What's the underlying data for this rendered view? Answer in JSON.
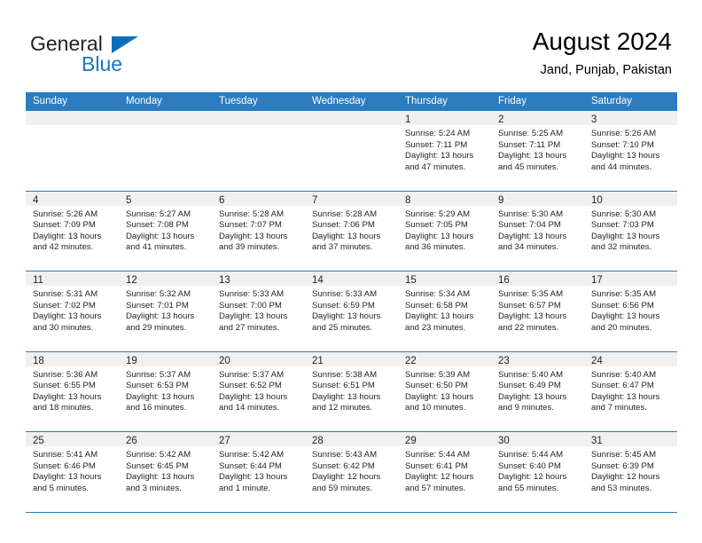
{
  "brand": {
    "name_part1": "General",
    "name_part2": "Blue",
    "triangle_icon": "brand-triangle-icon",
    "colors": {
      "general_text": "#231f20",
      "blue_text": "#1878bd",
      "triangle": "#0b6fba"
    }
  },
  "header": {
    "title": "August 2024",
    "subtitle": "Jand, Punjab, Pakistan"
  },
  "theme": {
    "header_bar": "#2b7cc0",
    "daynum_strip": "#f0f0f0",
    "row_divider": "#2b7cc0",
    "text": "#231f20"
  },
  "weekday_headers": [
    "Sunday",
    "Monday",
    "Tuesday",
    "Wednesday",
    "Thursday",
    "Friday",
    "Saturday"
  ],
  "weeks": [
    [
      {
        "day": "",
        "empty": true,
        "sunrise": "",
        "sunset": "",
        "daylight1": "",
        "daylight2": ""
      },
      {
        "day": "",
        "empty": true,
        "sunrise": "",
        "sunset": "",
        "daylight1": "",
        "daylight2": ""
      },
      {
        "day": "",
        "empty": true,
        "sunrise": "",
        "sunset": "",
        "daylight1": "",
        "daylight2": ""
      },
      {
        "day": "",
        "empty": true,
        "sunrise": "",
        "sunset": "",
        "daylight1": "",
        "daylight2": ""
      },
      {
        "day": "1",
        "empty": false,
        "sunrise": "Sunrise: 5:24 AM",
        "sunset": "Sunset: 7:11 PM",
        "daylight1": "Daylight: 13 hours",
        "daylight2": "and 47 minutes."
      },
      {
        "day": "2",
        "empty": false,
        "sunrise": "Sunrise: 5:25 AM",
        "sunset": "Sunset: 7:11 PM",
        "daylight1": "Daylight: 13 hours",
        "daylight2": "and 45 minutes."
      },
      {
        "day": "3",
        "empty": false,
        "sunrise": "Sunrise: 5:26 AM",
        "sunset": "Sunset: 7:10 PM",
        "daylight1": "Daylight: 13 hours",
        "daylight2": "and 44 minutes."
      }
    ],
    [
      {
        "day": "4",
        "empty": false,
        "sunrise": "Sunrise: 5:26 AM",
        "sunset": "Sunset: 7:09 PM",
        "daylight1": "Daylight: 13 hours",
        "daylight2": "and 42 minutes."
      },
      {
        "day": "5",
        "empty": false,
        "sunrise": "Sunrise: 5:27 AM",
        "sunset": "Sunset: 7:08 PM",
        "daylight1": "Daylight: 13 hours",
        "daylight2": "and 41 minutes."
      },
      {
        "day": "6",
        "empty": false,
        "sunrise": "Sunrise: 5:28 AM",
        "sunset": "Sunset: 7:07 PM",
        "daylight1": "Daylight: 13 hours",
        "daylight2": "and 39 minutes."
      },
      {
        "day": "7",
        "empty": false,
        "sunrise": "Sunrise: 5:28 AM",
        "sunset": "Sunset: 7:06 PM",
        "daylight1": "Daylight: 13 hours",
        "daylight2": "and 37 minutes."
      },
      {
        "day": "8",
        "empty": false,
        "sunrise": "Sunrise: 5:29 AM",
        "sunset": "Sunset: 7:05 PM",
        "daylight1": "Daylight: 13 hours",
        "daylight2": "and 36 minutes."
      },
      {
        "day": "9",
        "empty": false,
        "sunrise": "Sunrise: 5:30 AM",
        "sunset": "Sunset: 7:04 PM",
        "daylight1": "Daylight: 13 hours",
        "daylight2": "and 34 minutes."
      },
      {
        "day": "10",
        "empty": false,
        "sunrise": "Sunrise: 5:30 AM",
        "sunset": "Sunset: 7:03 PM",
        "daylight1": "Daylight: 13 hours",
        "daylight2": "and 32 minutes."
      }
    ],
    [
      {
        "day": "11",
        "empty": false,
        "sunrise": "Sunrise: 5:31 AM",
        "sunset": "Sunset: 7:02 PM",
        "daylight1": "Daylight: 13 hours",
        "daylight2": "and 30 minutes."
      },
      {
        "day": "12",
        "empty": false,
        "sunrise": "Sunrise: 5:32 AM",
        "sunset": "Sunset: 7:01 PM",
        "daylight1": "Daylight: 13 hours",
        "daylight2": "and 29 minutes."
      },
      {
        "day": "13",
        "empty": false,
        "sunrise": "Sunrise: 5:33 AM",
        "sunset": "Sunset: 7:00 PM",
        "daylight1": "Daylight: 13 hours",
        "daylight2": "and 27 minutes."
      },
      {
        "day": "14",
        "empty": false,
        "sunrise": "Sunrise: 5:33 AM",
        "sunset": "Sunset: 6:59 PM",
        "daylight1": "Daylight: 13 hours",
        "daylight2": "and 25 minutes."
      },
      {
        "day": "15",
        "empty": false,
        "sunrise": "Sunrise: 5:34 AM",
        "sunset": "Sunset: 6:58 PM",
        "daylight1": "Daylight: 13 hours",
        "daylight2": "and 23 minutes."
      },
      {
        "day": "16",
        "empty": false,
        "sunrise": "Sunrise: 5:35 AM",
        "sunset": "Sunset: 6:57 PM",
        "daylight1": "Daylight: 13 hours",
        "daylight2": "and 22 minutes."
      },
      {
        "day": "17",
        "empty": false,
        "sunrise": "Sunrise: 5:35 AM",
        "sunset": "Sunset: 6:56 PM",
        "daylight1": "Daylight: 13 hours",
        "daylight2": "and 20 minutes."
      }
    ],
    [
      {
        "day": "18",
        "empty": false,
        "sunrise": "Sunrise: 5:36 AM",
        "sunset": "Sunset: 6:55 PM",
        "daylight1": "Daylight: 13 hours",
        "daylight2": "and 18 minutes."
      },
      {
        "day": "19",
        "empty": false,
        "sunrise": "Sunrise: 5:37 AM",
        "sunset": "Sunset: 6:53 PM",
        "daylight1": "Daylight: 13 hours",
        "daylight2": "and 16 minutes."
      },
      {
        "day": "20",
        "empty": false,
        "sunrise": "Sunrise: 5:37 AM",
        "sunset": "Sunset: 6:52 PM",
        "daylight1": "Daylight: 13 hours",
        "daylight2": "and 14 minutes."
      },
      {
        "day": "21",
        "empty": false,
        "sunrise": "Sunrise: 5:38 AM",
        "sunset": "Sunset: 6:51 PM",
        "daylight1": "Daylight: 13 hours",
        "daylight2": "and 12 minutes."
      },
      {
        "day": "22",
        "empty": false,
        "sunrise": "Sunrise: 5:39 AM",
        "sunset": "Sunset: 6:50 PM",
        "daylight1": "Daylight: 13 hours",
        "daylight2": "and 10 minutes."
      },
      {
        "day": "23",
        "empty": false,
        "sunrise": "Sunrise: 5:40 AM",
        "sunset": "Sunset: 6:49 PM",
        "daylight1": "Daylight: 13 hours",
        "daylight2": "and 9 minutes."
      },
      {
        "day": "24",
        "empty": false,
        "sunrise": "Sunrise: 5:40 AM",
        "sunset": "Sunset: 6:47 PM",
        "daylight1": "Daylight: 13 hours",
        "daylight2": "and 7 minutes."
      }
    ],
    [
      {
        "day": "25",
        "empty": false,
        "sunrise": "Sunrise: 5:41 AM",
        "sunset": "Sunset: 6:46 PM",
        "daylight1": "Daylight: 13 hours",
        "daylight2": "and 5 minutes."
      },
      {
        "day": "26",
        "empty": false,
        "sunrise": "Sunrise: 5:42 AM",
        "sunset": "Sunset: 6:45 PM",
        "daylight1": "Daylight: 13 hours",
        "daylight2": "and 3 minutes."
      },
      {
        "day": "27",
        "empty": false,
        "sunrise": "Sunrise: 5:42 AM",
        "sunset": "Sunset: 6:44 PM",
        "daylight1": "Daylight: 13 hours",
        "daylight2": "and 1 minute."
      },
      {
        "day": "28",
        "empty": false,
        "sunrise": "Sunrise: 5:43 AM",
        "sunset": "Sunset: 6:42 PM",
        "daylight1": "Daylight: 12 hours",
        "daylight2": "and 59 minutes."
      },
      {
        "day": "29",
        "empty": false,
        "sunrise": "Sunrise: 5:44 AM",
        "sunset": "Sunset: 6:41 PM",
        "daylight1": "Daylight: 12 hours",
        "daylight2": "and 57 minutes."
      },
      {
        "day": "30",
        "empty": false,
        "sunrise": "Sunrise: 5:44 AM",
        "sunset": "Sunset: 6:40 PM",
        "daylight1": "Daylight: 12 hours",
        "daylight2": "and 55 minutes."
      },
      {
        "day": "31",
        "empty": false,
        "sunrise": "Sunrise: 5:45 AM",
        "sunset": "Sunset: 6:39 PM",
        "daylight1": "Daylight: 12 hours",
        "daylight2": "and 53 minutes."
      }
    ]
  ]
}
